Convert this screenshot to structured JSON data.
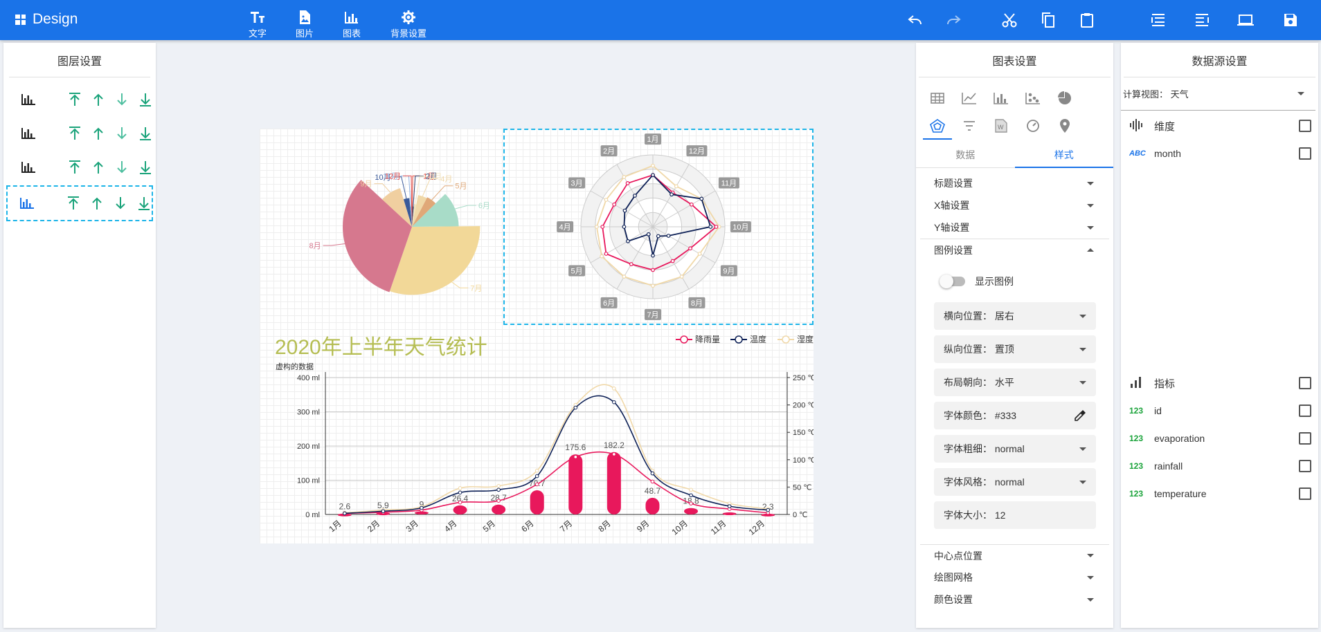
{
  "app": {
    "title": "Design"
  },
  "toolbar": {
    "text_label": "文字",
    "image_label": "图片",
    "chart_label": "图表",
    "background_label": "背景设置"
  },
  "layers_panel": {
    "title": "图层设置"
  },
  "chart_panel": {
    "title": "图表设置",
    "tabs": {
      "data": "数据",
      "style": "样式"
    },
    "sections": {
      "title": "标题设置",
      "xaxis": "X轴设置",
      "yaxis": "Y轴设置",
      "legend": "图例设置",
      "center": "中心点位置",
      "grid": "绘图网格",
      "color": "颜色设置"
    },
    "legend_settings": {
      "show_legend": "显示图例",
      "horizontal_label": "横向位置：",
      "horizontal_value": "居右",
      "vertical_label": "纵向位置：",
      "vertical_value": "置顶",
      "orient_label": "布局朝向：",
      "orient_value": "水平",
      "color_label": "字体颜色：",
      "color_value": "#333",
      "weight_label": "字体粗细：",
      "weight_value": "normal",
      "style_label": "字体风格：",
      "style_value": "normal",
      "size_label": "字体大小：",
      "size_value": "12"
    }
  },
  "datasource_panel": {
    "title": "数据源设置",
    "view_label": "计算视图：",
    "view_value": "天气",
    "dimension_title": "维度",
    "dimension_type": "ABC",
    "dimension_field": "month",
    "metric_title": "指标",
    "metric_type": "123",
    "metrics": [
      "id",
      "evaporation",
      "rainfall",
      "temperature"
    ]
  },
  "colors": {
    "primary": "#1a73e8",
    "rain": "#e8185c",
    "temp": "#0c1f55",
    "humid": "#f0d8a8",
    "title_green": "#b5bd52"
  },
  "chart_data": [
    {
      "type": "pie",
      "slices": [
        {
          "label": "1月",
          "value": 2.6,
          "color": "#e84c3d"
        },
        {
          "label": "2月",
          "value": 5.9,
          "color": "#2b3a67"
        },
        {
          "label": "3月",
          "value": 9.0,
          "color": "#f2e4c0"
        },
        {
          "label": "4月",
          "value": 26.4,
          "color": "#f0d8a8"
        },
        {
          "label": "5月",
          "value": 28.7,
          "color": "#e0a878"
        },
        {
          "label": "6月",
          "value": 70.7,
          "color": "#a8dcc8"
        },
        {
          "label": "7月",
          "value": 175.6,
          "color": "#f2d898"
        },
        {
          "label": "8月",
          "value": 182.2,
          "color": "#d6788e"
        },
        {
          "label": "9月",
          "value": 48.7,
          "color": "#f0cfa0"
        },
        {
          "label": "10月",
          "value": 18.8,
          "color": "#3a5a9a"
        },
        {
          "label": "11月",
          "value": 6.0,
          "color": "#8fb2e0"
        },
        {
          "label": "12月",
          "value": 2.3,
          "color": "#e04848"
        }
      ]
    },
    {
      "type": "radar",
      "indicators": [
        "1月",
        "12月",
        "11月",
        "10月",
        "9月",
        "8月",
        "7月",
        "6月",
        "5月",
        "4月",
        "3月",
        "2月"
      ],
      "series": [
        {
          "values": [
            0.72,
            0.55,
            0.62,
            0.88,
            0.6,
            0.55,
            0.6,
            0.6,
            0.75,
            0.7,
            0.62,
            0.7
          ]
        },
        {
          "values": [
            0.72,
            0.52,
            0.78,
            0.8,
            0.25,
            0.15,
            0.4,
            0.12,
            0.4,
            0.4,
            0.45,
            0.5
          ]
        },
        {
          "values": [
            0.85,
            0.65,
            0.78,
            0.92,
            0.75,
            0.8,
            0.82,
            0.8,
            0.82,
            0.78,
            0.75,
            0.8
          ]
        }
      ]
    },
    {
      "type": "bar",
      "title": "2020年上半年天气统计",
      "subtitle": "虚构的数据",
      "categories": [
        "1月",
        "2月",
        "3月",
        "4月",
        "5月",
        "6月",
        "7月",
        "8月",
        "9月",
        "10月",
        "11月",
        "12月"
      ],
      "y_left": {
        "ticks": [
          "0 ml",
          "100 ml",
          "200 ml",
          "300 ml",
          "400 ml"
        ],
        "max": 400
      },
      "y_right": {
        "ticks": [
          "0 ℃",
          "50 ℃",
          "100 ℃",
          "150 ℃",
          "200 ℃",
          "250 ℃"
        ],
        "max": 250
      },
      "legend": [
        "降雨量",
        "温度",
        "湿度"
      ],
      "series": [
        {
          "name": "降雨量",
          "type": "bar",
          "values": [
            2.6,
            5.9,
            9.0,
            26.4,
            28.7,
            70.7,
            175.6,
            182.2,
            48.7,
            18.8,
            6.0,
            2.3
          ]
        },
        {
          "name": "降雨量",
          "type": "line",
          "values": [
            2.0,
            4.0,
            8.0,
            22.0,
            25.0,
            55.0,
            105.0,
            110.0,
            60.0,
            20.0,
            10.0,
            3.0
          ]
        },
        {
          "name": "温度",
          "type": "line",
          "values": [
            2.0,
            6.0,
            12.0,
            40.0,
            45.0,
            70.0,
            195.0,
            205.0,
            75.0,
            35.0,
            15.0,
            8.0
          ]
        },
        {
          "name": "湿度",
          "type": "line",
          "values": [
            3.0,
            8.0,
            14.0,
            48.0,
            52.0,
            80.0,
            200.0,
            230.0,
            80.0,
            45.0,
            20.0,
            10.0
          ]
        }
      ],
      "data_labels": [
        "2.6",
        "5.9",
        "9",
        "26.4",
        "28.7",
        "70.7",
        "175.6",
        "182.2",
        "48.7",
        "18.8",
        "6",
        "2.3"
      ]
    }
  ]
}
